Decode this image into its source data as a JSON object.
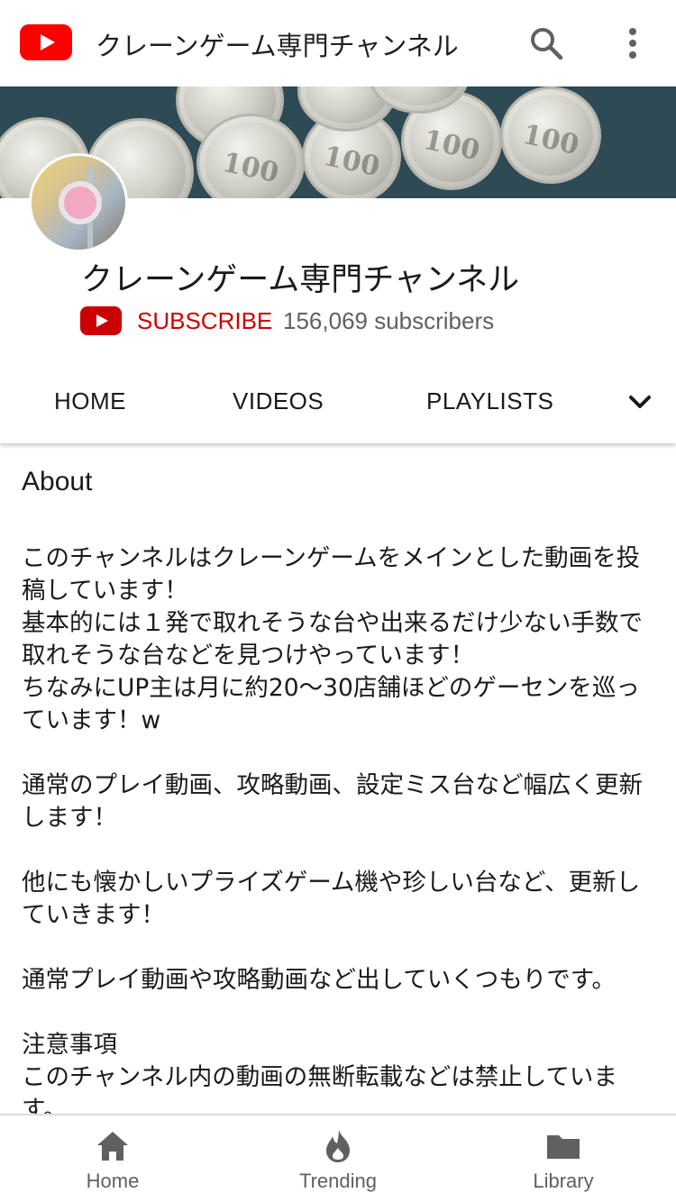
{
  "app": {
    "title": "クレーンゲーム専門チャンネル",
    "brand_color": "#ff0000",
    "icons": [
      "youtube-logo-icon",
      "search-icon",
      "more-vertical-icon"
    ]
  },
  "banner": {
    "coin_text": [
      "100",
      "100",
      "100",
      "100",
      "100"
    ]
  },
  "channel": {
    "name": "クレーンゲーム専門チャンネル",
    "subscribe_label": "SUBSCRIBE",
    "subscribers": "156,069 subscribers",
    "subscribe_color": "#cc0000"
  },
  "tabs": [
    {
      "label": "HOME"
    },
    {
      "label": "VIDEOS"
    },
    {
      "label": "PLAYLISTS"
    }
  ],
  "about": {
    "title": "About",
    "paragraphs": [
      "このチャンネルはクレーンゲームをメインとした動画を投稿しています！\n基本的には１発で取れそうな台や出来るだけ少ない手数で取れそうな台などを見つけやっています！\nちなみにUP主は月に約20〜30店舗ほどのゲーセンを巡っています！w",
      "通常のプレイ動画、攻略動画、設定ミス台など幅広く更新します！",
      "他にも懐かしいプライズゲーム機や珍しい台など、更新していきます！",
      "通常プレイ動画や攻略動画など出していくつもりです。",
      "注意事項\nこのチャンネル内の動画の無断転載などは禁止しています。"
    ]
  },
  "bottom_nav": [
    {
      "label": "Home",
      "icon": "home-icon"
    },
    {
      "label": "Trending",
      "icon": "trending-flame-icon"
    },
    {
      "label": "Library",
      "icon": "library-folder-icon"
    }
  ]
}
